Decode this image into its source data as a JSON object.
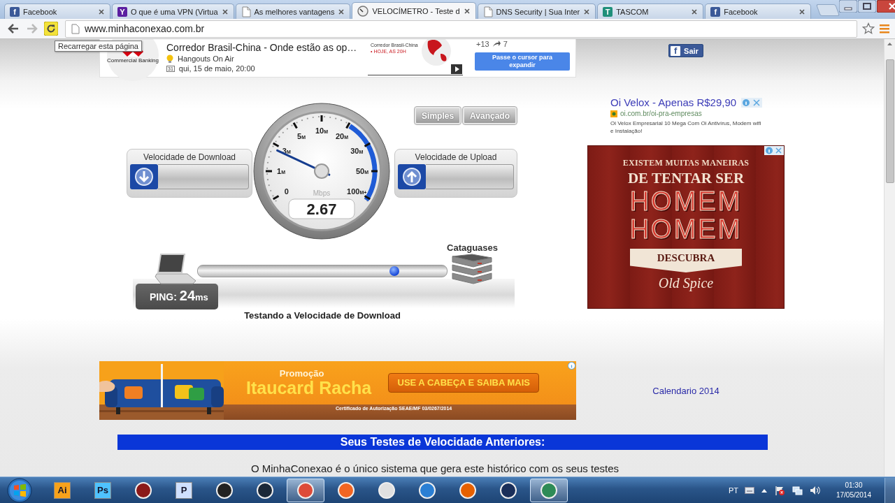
{
  "browser": {
    "tabs": [
      {
        "title": "Facebook",
        "icon": {
          "kind": "letter",
          "glyph": "f",
          "color": "#3b5998"
        },
        "selected": false
      },
      {
        "title": "O que é uma VPN (Virtua",
        "icon": {
          "kind": "letter",
          "glyph": "Y",
          "color": "#5b1fa0"
        },
        "selected": false
      },
      {
        "title": "As melhores vantagens",
        "icon": {
          "kind": "page"
        },
        "selected": false
      },
      {
        "title": "VELOCÍMETRO - Teste d",
        "icon": {
          "kind": "gauge"
        },
        "selected": true
      },
      {
        "title": "DNS Security | Sua Inter",
        "icon": {
          "kind": "page"
        },
        "selected": false
      },
      {
        "title": "TASCOM",
        "icon": {
          "kind": "letter",
          "glyph": "T",
          "color": "#1f8f7a"
        },
        "selected": false
      },
      {
        "title": "Facebook",
        "icon": {
          "kind": "letter",
          "glyph": "f",
          "color": "#3b5998"
        },
        "selected": false
      }
    ],
    "url": "www.minhaconexao.com.br",
    "tooltip": "Recarregar esta página"
  },
  "top_ad": {
    "brand": "Commercial Banking",
    "title": "Corredor Brasil-China - Onde estão as op…",
    "channel": "Hangouts On Air",
    "date_icon": "31",
    "date": "qui, 15 de maio, 20:00",
    "thumb_title": "Corredor Brasil-China",
    "thumb_note": "• HOJE, AS 20H",
    "plus_count": "+13",
    "share_count": "7",
    "cta": "Passe o cursor para expandir"
  },
  "facebook_button": {
    "glyph": "f",
    "label": "Sair"
  },
  "speedtest": {
    "modes": [
      {
        "label": "Simples"
      },
      {
        "label": "Avançado"
      }
    ],
    "download": {
      "label": "Velocidade de Download"
    },
    "upload": {
      "label": "Velocidade de Upload"
    },
    "gauge": {
      "ticks": [
        {
          "value": "0"
        },
        {
          "value": "1",
          "unit": "M"
        },
        {
          "value": "3",
          "unit": "M"
        },
        {
          "value": "5",
          "unit": "M"
        },
        {
          "value": "10",
          "unit": "M"
        },
        {
          "value": "20",
          "unit": "M"
        },
        {
          "value": "30",
          "unit": "M"
        },
        {
          "value": "50",
          "unit": "M"
        },
        {
          "value": "100",
          "unit": "M+"
        }
      ],
      "unit": "Mbps",
      "reading": "2.67"
    },
    "server": "Cataguases",
    "transfer": {
      "level": 0.79
    },
    "ping": {
      "label": "PING:",
      "value": "24",
      "unit": "ms"
    },
    "status": "Testando a Velocidade de Download"
  },
  "text_ad": {
    "title": "Oi Velox - Apenas R$29,90",
    "url": "oi.com.br/oi-pra-empresas",
    "description": "Oi Velox Empresarial 10 Mega Com Oi Antivírus, Modem wifi e Instalação!"
  },
  "image_ad": {
    "lines": [
      {
        "text": "EXISTEM MUITAS MANEIRAS",
        "kind": "small"
      },
      {
        "text": "DE TENTAR SER",
        "kind": "medium"
      },
      {
        "text": "HOMEM",
        "kind": "outline"
      },
      {
        "text": "HOMEM",
        "kind": "outline"
      }
    ],
    "cta": "DESCUBRA",
    "brand": "Old Spice"
  },
  "banner": {
    "kicker": "Promoção",
    "title": "Itaucard Racha",
    "cta": "USE A CABEÇA E SAIBA MAIS",
    "footnote": "Certificado de Autorização SEAE/MF 03/0267/2014"
  },
  "calendar_link": "Calendario 2014",
  "history": {
    "heading": "Seus Testes de Velocidade Anteriores:",
    "intro": "O MinhaConexao é o único sistema que gera este histórico com os seus testes"
  },
  "taskbar": {
    "apps": [
      {
        "kind": "tile",
        "label": "Ai",
        "color": "#f7a21b",
        "active": false
      },
      {
        "kind": "tile",
        "label": "Ps",
        "color": "#4fc3ff",
        "active": false
      },
      {
        "kind": "round",
        "color": "#8b1a1a",
        "active": false
      },
      {
        "kind": "tile",
        "label": "P",
        "color": "#cfe0ff",
        "active": false
      },
      {
        "kind": "round",
        "color": "#222222",
        "active": false
      },
      {
        "kind": "round",
        "color": "#1b2838",
        "active": false
      },
      {
        "kind": "round",
        "color": "#dd4b39",
        "active": true
      },
      {
        "kind": "round",
        "color": "#f26522",
        "active": false
      },
      {
        "kind": "round",
        "color": "#e0e0e0",
        "active": false
      },
      {
        "kind": "round",
        "color": "#2a7fd4",
        "active": false
      },
      {
        "kind": "round",
        "color": "#e66000",
        "active": false
      },
      {
        "kind": "round",
        "color": "#1a2f5a",
        "active": false
      },
      {
        "kind": "round",
        "color": "#2e8b57",
        "active": true
      }
    ],
    "tray": {
      "language": "PT",
      "time": "01:30",
      "date": "17/05/2014"
    }
  }
}
